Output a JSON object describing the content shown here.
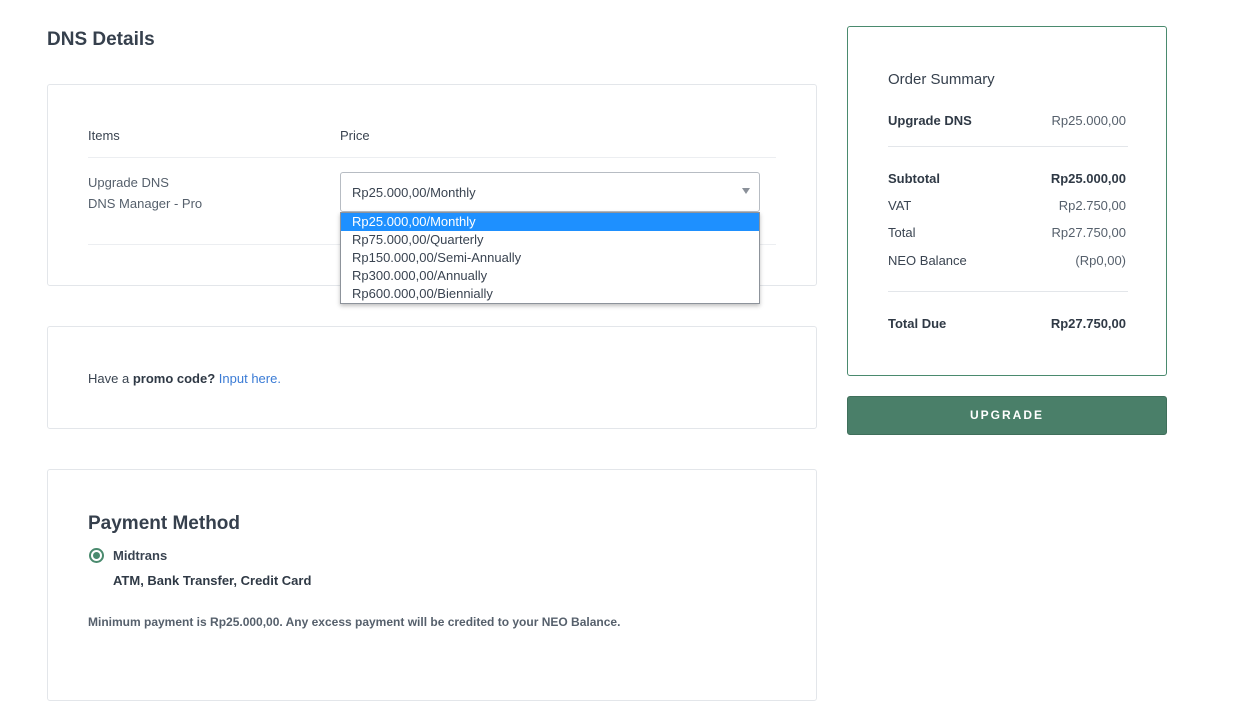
{
  "page": {
    "title": "DNS Details"
  },
  "items_table": {
    "headers": {
      "items": "Items",
      "price": "Price"
    },
    "row": {
      "name": "Upgrade DNS",
      "subtitle": "DNS Manager - Pro",
      "selected_price": "Rp25.000,00/Monthly",
      "options": [
        "Rp25.000,00/Monthly",
        "Rp75.000,00/Quarterly",
        "Rp150.000,00/Semi-Annually",
        "Rp300.000,00/Annually",
        "Rp600.000,00/Biennially"
      ],
      "highlighted_option_index": 0
    }
  },
  "promo": {
    "prefix": "Have a",
    "bold": "promo code?",
    "link": "Input here."
  },
  "payment": {
    "title": "Payment Method",
    "method_label": "Midtrans",
    "method_sub": "ATM, Bank Transfer, Credit Card",
    "note": "Minimum payment is Rp25.000,00. Any excess payment will be credited to your NEO Balance."
  },
  "summary": {
    "title": "Order Summary",
    "item": {
      "label": "Upgrade DNS",
      "value": "Rp25.000,00"
    },
    "subtotal": {
      "label": "Subtotal",
      "value": "Rp25.000,00"
    },
    "vat": {
      "label": "VAT",
      "value": "Rp2.750,00"
    },
    "total": {
      "label": "Total",
      "value": "Rp27.750,00"
    },
    "neo_balance": {
      "label": "NEO Balance",
      "value": "(Rp0,00)"
    },
    "total_due": {
      "label": "Total Due",
      "value": "Rp27.750,00"
    }
  },
  "actions": {
    "upgrade_label": "UPGRADE"
  },
  "colors": {
    "accent": "#4a7f69",
    "link": "#3a7bd5",
    "highlight": "#1e90ff"
  }
}
